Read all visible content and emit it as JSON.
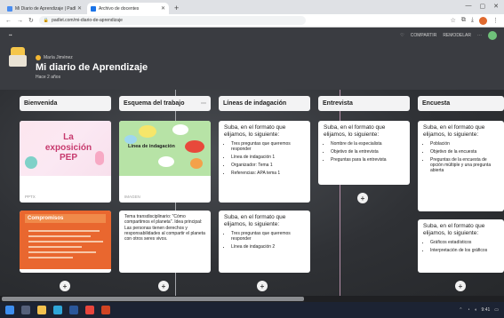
{
  "browser": {
    "tabs": [
      {
        "title": "Mi Diario de Aprendizaje | Padlet"
      },
      {
        "title": "Archivo de docentes"
      }
    ],
    "url": "padlet.com/mi-diario-de-aprendizaje"
  },
  "padlet": {
    "author": "María Jiménez",
    "title": "Mi diario de Aprendizaje",
    "subtitle": "Hace 2 años",
    "top_actions": [
      "COMPARTIR",
      "REMODELAR"
    ]
  },
  "columns": [
    {
      "title": "Bienvenida"
    },
    {
      "title": "Esquema del trabajo"
    },
    {
      "title": "Líneas de indagación"
    },
    {
      "title": "Entrevista"
    },
    {
      "title": "Encuesta"
    }
  ],
  "cards": {
    "expo_title": "La exposición PEP",
    "expo_foot": "PPTX",
    "esquema_label": "Línea de indagación",
    "esquema_foot": "IMAGEN",
    "compromisos_title": "Compromisos",
    "transdisciplinario_text": "Tema transdisciplinario: \"Cómo compartimos el planeta\". Idea principal: Las personas tienen derechos y responsabilidades al compartir el planeta con otros seres vivos.",
    "lineas1_intro": "Suba, en el formato que elijamos, lo siguiente:",
    "lineas1_items": [
      "Tres preguntas que queremos responder",
      "Línea de indagación 1",
      "Organizador: Tema 1",
      "Referencias: APA tema 1"
    ],
    "lineas2_intro": "Suba, en el formato que elijamos, lo siguiente:",
    "lineas2_items": [
      "Tres preguntas que queremos responder",
      "Línea de indagación 2"
    ],
    "entrevista_intro": "Suba, en el formato que elijamos, lo siguiente:",
    "entrevista_items": [
      "Nombre de la especialista",
      "Objetivo de la entrevista",
      "Preguntas para la entrevista"
    ],
    "encuesta1_intro": "Suba, en el formato que elijamos, lo siguiente:",
    "encuesta1_items": [
      "Población",
      "Objetivo de la encuesta",
      "Preguntas de la encuesta de opción múltiple y una pregunta abierta"
    ],
    "encuesta2_intro": "Suba, en el formato que elijamos, lo siguiente:",
    "encuesta2_items": [
      "Gráficos estadísticos",
      "Interpretación de los gráficos"
    ]
  },
  "taskbar": {
    "time": "9:41"
  }
}
